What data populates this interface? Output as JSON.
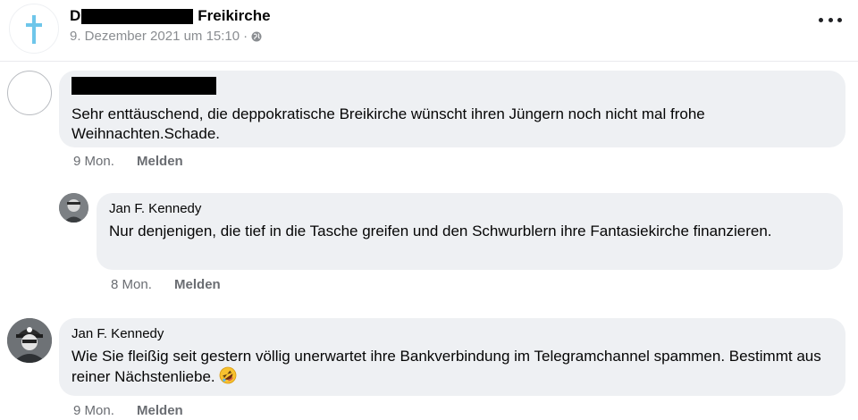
{
  "post": {
    "page_name_prefix": "D",
    "page_name_suffix": "Freikirche",
    "timestamp": "9. Dezember 2021 um 15:10",
    "separator": "·",
    "privacy_icon": "globe-icon",
    "more_icon": "more-dots-icon"
  },
  "comments": [
    {
      "author": "",
      "author_redacted": true,
      "text": "Sehr enttäuschend, die deppokratische Breikirche wünscht ihren Jüngern noch nicht mal frohe Weihnachten.Schade.",
      "age": "9 Mon.",
      "report_label": "Melden"
    },
    {
      "author": "Jan F. Kennedy",
      "text": "Nur denjenigen, die tief in die Tasche greifen und den Schwurblern ihre Fantasiekirche finanzieren.",
      "age": "8 Mon.",
      "report_label": "Melden"
    },
    {
      "author": "Jan F. Kennedy",
      "text": "Wie Sie fleißig seit gestern völlig unerwartet ihre Bankverbindung im Telegramchannel spammen. Bestimmt aus reiner Nächstenliebe.",
      "emoji": "rolling-on-floor-laughing-emoji",
      "age": "9 Mon.",
      "report_label": "Melden"
    }
  ],
  "colors": {
    "bubble": "#eef0f3",
    "meta_text": "#8a8d91",
    "action_text": "#6a6d72",
    "cross": "#6ec6ea"
  }
}
